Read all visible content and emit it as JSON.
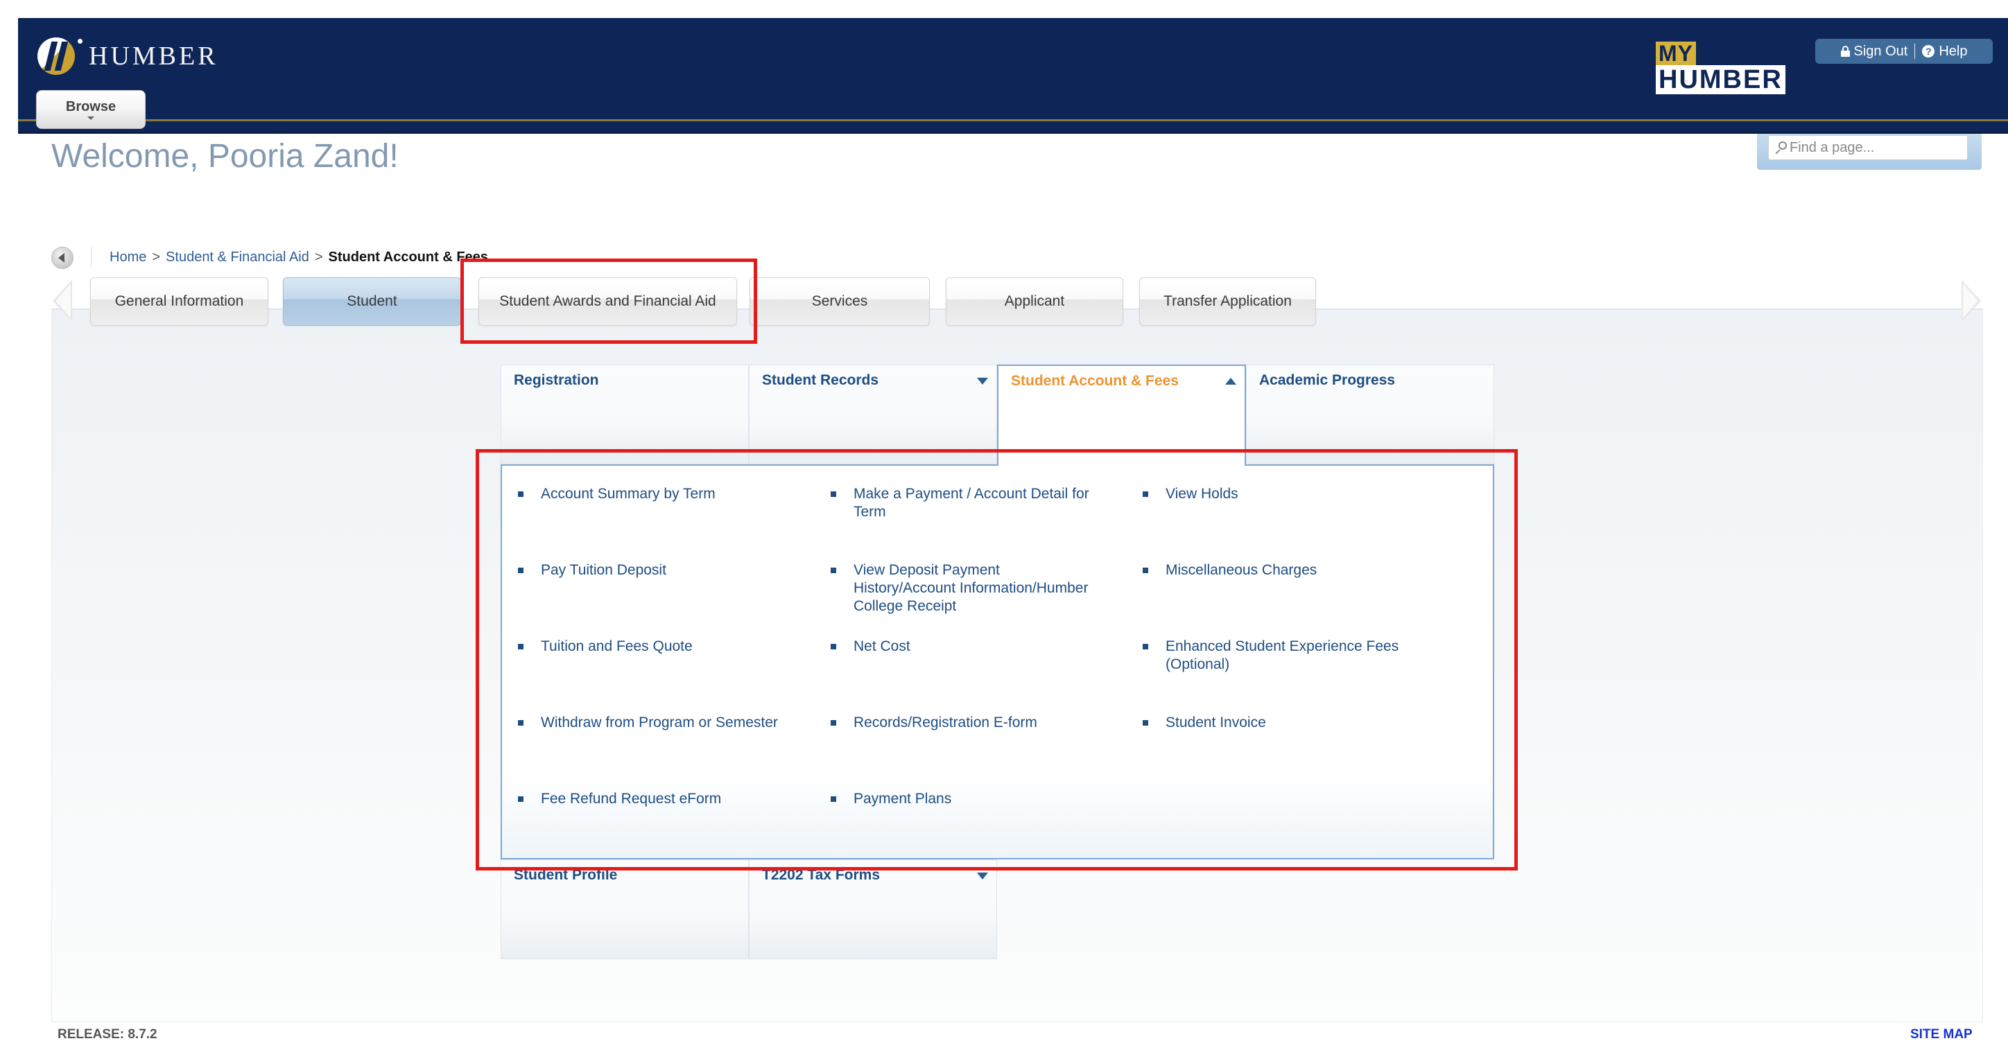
{
  "header": {
    "logo_text": "HUMBER",
    "browse_label": "Browse",
    "myhumber_top": "MY",
    "myhumber_bottom": "HUMBER",
    "sign_out_label": "Sign Out",
    "help_label": "Help",
    "help_glyph": "?",
    "search_placeholder": "Find a page..."
  },
  "welcome": "Welcome, Pooria Zand!",
  "breadcrumb": {
    "items": [
      "Home",
      "Student & Financial Aid",
      "Student Account & Fees"
    ],
    "separator": ">"
  },
  "tabs": [
    {
      "label": "General Information",
      "active": false
    },
    {
      "label": "Student",
      "active": true
    },
    {
      "label": "Student Awards and Financial Aid",
      "active": false
    },
    {
      "label": "Services",
      "active": false
    },
    {
      "label": "Applicant",
      "active": false
    },
    {
      "label": "Transfer Application",
      "active": false
    }
  ],
  "menu": {
    "row1": [
      {
        "title": "Registration",
        "caret": "none"
      },
      {
        "title": "Student Records",
        "caret": "down"
      },
      {
        "title": "Student Account & Fees",
        "caret": "up",
        "open": true
      },
      {
        "title": "Academic Progress",
        "caret": "none"
      }
    ],
    "row2": [
      {
        "title": "Student Profile",
        "caret": "none"
      },
      {
        "title": "T2202 Tax Forms",
        "caret": "down"
      }
    ]
  },
  "dropdown_items": [
    [
      "Account Summary by Term",
      "Make a Payment / Account Detail for Term",
      "View Holds"
    ],
    [
      "Pay Tuition Deposit",
      "View Deposit Payment History/Account Information/Humber College Receipt",
      "Miscellaneous Charges"
    ],
    [
      "Tuition and Fees Quote",
      "Net Cost",
      "Enhanced Student Experience Fees (Optional)"
    ],
    [
      "Withdraw from Program or Semester",
      "Records/Registration E-form",
      "Student Invoice"
    ],
    [
      "Fee Refund Request eForm",
      "Payment Plans"
    ]
  ],
  "footer": {
    "release": "RELEASE: 8.7.2",
    "site_map": "SITE MAP"
  },
  "colors": {
    "header_navy": "#0e2657",
    "accent_gold": "#c9a233",
    "link_blue": "#1e4d82",
    "active_menu_orange": "#ec9332",
    "highlight_red": "#e31b1b"
  }
}
